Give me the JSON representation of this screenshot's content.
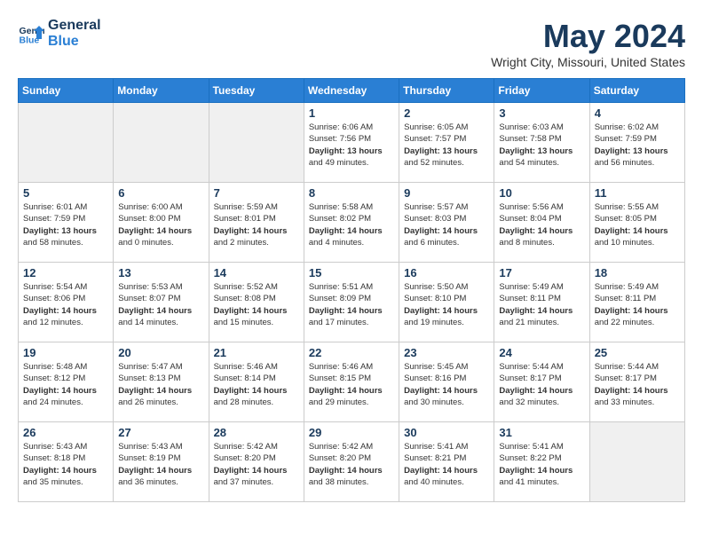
{
  "header": {
    "logo_line1": "General",
    "logo_line2": "Blue",
    "month": "May 2024",
    "location": "Wright City, Missouri, United States"
  },
  "weekdays": [
    "Sunday",
    "Monday",
    "Tuesday",
    "Wednesday",
    "Thursday",
    "Friday",
    "Saturday"
  ],
  "weeks": [
    [
      {
        "day": "",
        "info": "",
        "shaded": true
      },
      {
        "day": "",
        "info": "",
        "shaded": true
      },
      {
        "day": "",
        "info": "",
        "shaded": true
      },
      {
        "day": "1",
        "info": "Sunrise: 6:06 AM\nSunset: 7:56 PM\nDaylight: 13 hours\nand 49 minutes."
      },
      {
        "day": "2",
        "info": "Sunrise: 6:05 AM\nSunset: 7:57 PM\nDaylight: 13 hours\nand 52 minutes."
      },
      {
        "day": "3",
        "info": "Sunrise: 6:03 AM\nSunset: 7:58 PM\nDaylight: 13 hours\nand 54 minutes."
      },
      {
        "day": "4",
        "info": "Sunrise: 6:02 AM\nSunset: 7:59 PM\nDaylight: 13 hours\nand 56 minutes."
      }
    ],
    [
      {
        "day": "5",
        "info": "Sunrise: 6:01 AM\nSunset: 7:59 PM\nDaylight: 13 hours\nand 58 minutes."
      },
      {
        "day": "6",
        "info": "Sunrise: 6:00 AM\nSunset: 8:00 PM\nDaylight: 14 hours\nand 0 minutes."
      },
      {
        "day": "7",
        "info": "Sunrise: 5:59 AM\nSunset: 8:01 PM\nDaylight: 14 hours\nand 2 minutes."
      },
      {
        "day": "8",
        "info": "Sunrise: 5:58 AM\nSunset: 8:02 PM\nDaylight: 14 hours\nand 4 minutes."
      },
      {
        "day": "9",
        "info": "Sunrise: 5:57 AM\nSunset: 8:03 PM\nDaylight: 14 hours\nand 6 minutes."
      },
      {
        "day": "10",
        "info": "Sunrise: 5:56 AM\nSunset: 8:04 PM\nDaylight: 14 hours\nand 8 minutes."
      },
      {
        "day": "11",
        "info": "Sunrise: 5:55 AM\nSunset: 8:05 PM\nDaylight: 14 hours\nand 10 minutes."
      }
    ],
    [
      {
        "day": "12",
        "info": "Sunrise: 5:54 AM\nSunset: 8:06 PM\nDaylight: 14 hours\nand 12 minutes."
      },
      {
        "day": "13",
        "info": "Sunrise: 5:53 AM\nSunset: 8:07 PM\nDaylight: 14 hours\nand 14 minutes."
      },
      {
        "day": "14",
        "info": "Sunrise: 5:52 AM\nSunset: 8:08 PM\nDaylight: 14 hours\nand 15 minutes."
      },
      {
        "day": "15",
        "info": "Sunrise: 5:51 AM\nSunset: 8:09 PM\nDaylight: 14 hours\nand 17 minutes."
      },
      {
        "day": "16",
        "info": "Sunrise: 5:50 AM\nSunset: 8:10 PM\nDaylight: 14 hours\nand 19 minutes."
      },
      {
        "day": "17",
        "info": "Sunrise: 5:49 AM\nSunset: 8:11 PM\nDaylight: 14 hours\nand 21 minutes."
      },
      {
        "day": "18",
        "info": "Sunrise: 5:49 AM\nSunset: 8:11 PM\nDaylight: 14 hours\nand 22 minutes."
      }
    ],
    [
      {
        "day": "19",
        "info": "Sunrise: 5:48 AM\nSunset: 8:12 PM\nDaylight: 14 hours\nand 24 minutes."
      },
      {
        "day": "20",
        "info": "Sunrise: 5:47 AM\nSunset: 8:13 PM\nDaylight: 14 hours\nand 26 minutes."
      },
      {
        "day": "21",
        "info": "Sunrise: 5:46 AM\nSunset: 8:14 PM\nDaylight: 14 hours\nand 28 minutes."
      },
      {
        "day": "22",
        "info": "Sunrise: 5:46 AM\nSunset: 8:15 PM\nDaylight: 14 hours\nand 29 minutes."
      },
      {
        "day": "23",
        "info": "Sunrise: 5:45 AM\nSunset: 8:16 PM\nDaylight: 14 hours\nand 30 minutes."
      },
      {
        "day": "24",
        "info": "Sunrise: 5:44 AM\nSunset: 8:17 PM\nDaylight: 14 hours\nand 32 minutes."
      },
      {
        "day": "25",
        "info": "Sunrise: 5:44 AM\nSunset: 8:17 PM\nDaylight: 14 hours\nand 33 minutes."
      }
    ],
    [
      {
        "day": "26",
        "info": "Sunrise: 5:43 AM\nSunset: 8:18 PM\nDaylight: 14 hours\nand 35 minutes."
      },
      {
        "day": "27",
        "info": "Sunrise: 5:43 AM\nSunset: 8:19 PM\nDaylight: 14 hours\nand 36 minutes."
      },
      {
        "day": "28",
        "info": "Sunrise: 5:42 AM\nSunset: 8:20 PM\nDaylight: 14 hours\nand 37 minutes."
      },
      {
        "day": "29",
        "info": "Sunrise: 5:42 AM\nSunset: 8:20 PM\nDaylight: 14 hours\nand 38 minutes."
      },
      {
        "day": "30",
        "info": "Sunrise: 5:41 AM\nSunset: 8:21 PM\nDaylight: 14 hours\nand 40 minutes."
      },
      {
        "day": "31",
        "info": "Sunrise: 5:41 AM\nSunset: 8:22 PM\nDaylight: 14 hours\nand 41 minutes."
      },
      {
        "day": "",
        "info": "",
        "shaded": true
      }
    ]
  ]
}
